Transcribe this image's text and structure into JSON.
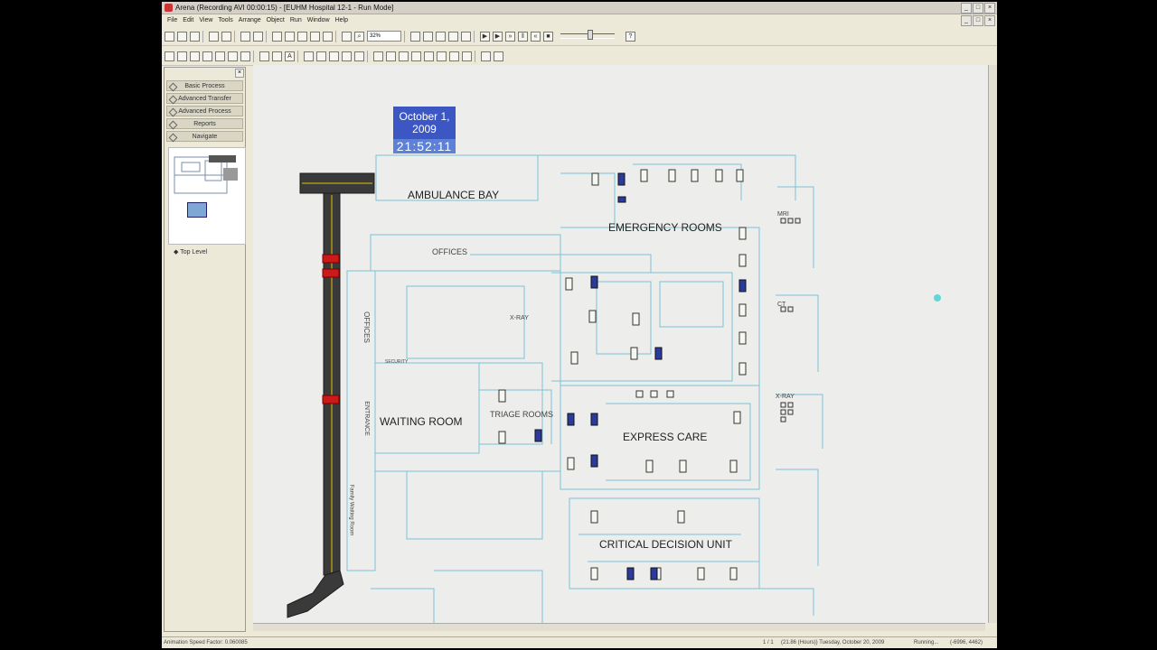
{
  "app": {
    "title": "Arena (Recording AVI 00:00:15) - [EUHM Hospital 12-1 - Run Mode]",
    "menu": [
      "File",
      "Edit",
      "View",
      "Tools",
      "Arrange",
      "Object",
      "Run",
      "Window",
      "Help"
    ],
    "zoom": "32%"
  },
  "sidebar": {
    "panels": [
      "Basic Process",
      "Advanced Transfer",
      "Advanced Process",
      "Reports",
      "Navigate"
    ],
    "tree_item": "Top Level"
  },
  "canvas": {
    "date": "October 1, 2009",
    "time": "21:52:11",
    "labels": {
      "ambulance_bay": "AMBULANCE BAY",
      "emergency_rooms": "EMERGENCY ROOMS",
      "offices_top": "OFFICES",
      "offices_side": "OFFICES",
      "waiting_room": "WAITING ROOM",
      "triage_rooms": "TRIAGE ROOMS",
      "express_care": "EXPRESS CARE",
      "critical_decision_unit": "CRITICAL DECISION UNIT",
      "entrance": "ENTRANCE",
      "xray": "X-RAY",
      "xray_right": "X-RAY",
      "mri": "MRI",
      "ct": "CT",
      "family_waiting_room": "Family Waiting Room",
      "security": "SECURITY"
    }
  },
  "status": {
    "animation_speed": "Animation Speed Factor: 0.060085",
    "page": "1 / 1",
    "sim_time": "(21.86 (Hours)) Tuesday, October 20, 2009",
    "state": "Running...",
    "coords": "(-6996, 4462)"
  },
  "colors": {
    "walls": "#79c3d8",
    "date_bg": "#3c57c4",
    "road": "#2e2e2e",
    "road_line": "#e8c400",
    "ambulance": "#cc1a1a",
    "bed": "#f7f7f2",
    "patient": "#2b3a9e"
  }
}
